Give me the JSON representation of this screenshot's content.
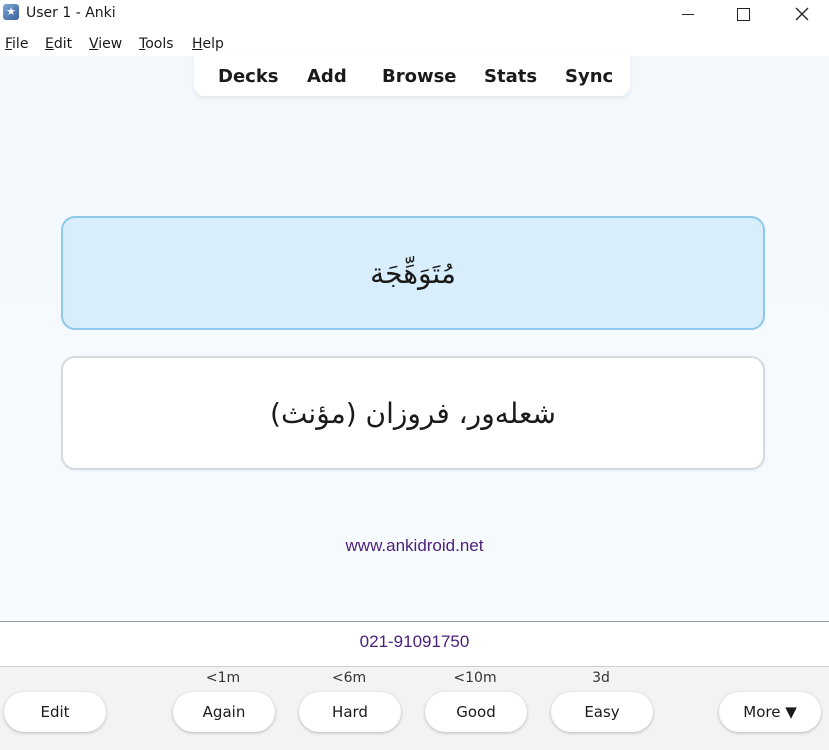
{
  "window": {
    "title": "User 1 - Anki",
    "icon": "anki-star-icon"
  },
  "menu": [
    {
      "label": "File",
      "mnemonic": "F",
      "rest": "ile"
    },
    {
      "label": "Edit",
      "mnemonic": "E",
      "rest": "dit"
    },
    {
      "label": "View",
      "mnemonic": "V",
      "rest": "iew"
    },
    {
      "label": "Tools",
      "mnemonic": "T",
      "rest": "ools"
    },
    {
      "label": "Help",
      "mnemonic": "H",
      "rest": "elp"
    }
  ],
  "toolbar": {
    "decks": "Decks",
    "add": "Add",
    "browse": "Browse",
    "stats": "Stats",
    "sync": "Sync"
  },
  "card": {
    "front": "مُتَوَهِّجَة",
    "back": "شعلەور، فروزان (مؤنث)"
  },
  "footer": {
    "website": "www.ankidroid.net",
    "phone": "021-91091750"
  },
  "answer_bar": {
    "edit": "Edit",
    "again": {
      "label": "Again",
      "interval": "<1m"
    },
    "hard": {
      "label": "Hard",
      "interval": "<6m"
    },
    "good": {
      "label": "Good",
      "interval": "<10m"
    },
    "easy": {
      "label": "Easy",
      "interval": "3d"
    },
    "more": "More ▼"
  },
  "colors": {
    "front_bg": "#d9eefc",
    "front_border": "#8ec8ea",
    "link_purple": "#4a1f7a"
  }
}
